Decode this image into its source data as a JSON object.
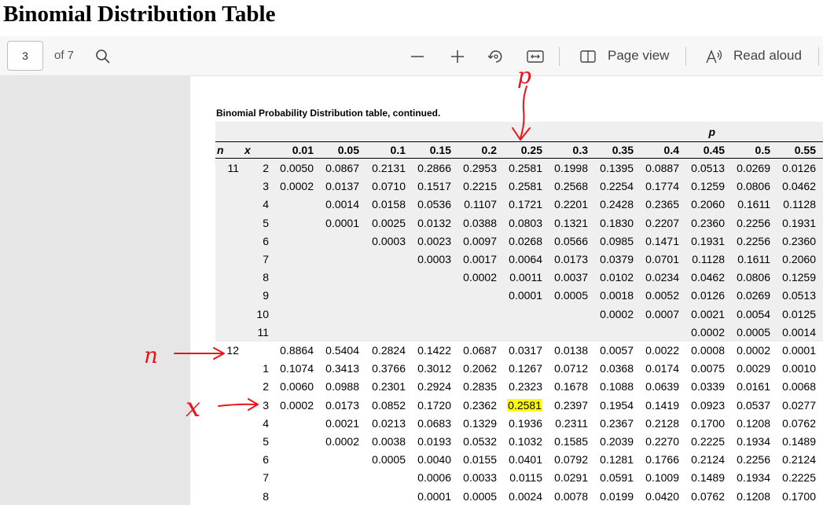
{
  "title": "Binomial Distribution Table",
  "toolbar": {
    "page_number": "3",
    "page_of": "of 7",
    "page_view_label": "Page view",
    "read_aloud_label": "Read aloud",
    "icons": [
      "search-icon",
      "zoom-out-icon",
      "zoom-in-icon",
      "rotate-icon",
      "fit-width-icon",
      "page-view-icon",
      "read-aloud-icon"
    ]
  },
  "document": {
    "caption": "Binomial Probability Distribution table, continued.",
    "p_header": "p",
    "n_header": "n",
    "x_header": "x",
    "p_values": [
      "0.01",
      "0.05",
      "0.1",
      "0.15",
      "0.2",
      "0.25",
      "0.3",
      "0.35",
      "0.4",
      "0.45",
      "0.5",
      "0.55"
    ],
    "rows": [
      {
        "n": "11",
        "x": "2",
        "cells": [
          "0.0050",
          "0.0867",
          "0.2131",
          "0.2866",
          "0.2953",
          "0.2581",
          "0.1998",
          "0.1395",
          "0.0887",
          "0.0513",
          "0.0269",
          "0.0126"
        ]
      },
      {
        "n": "",
        "x": "3",
        "cells": [
          "0.0002",
          "0.0137",
          "0.0710",
          "0.1517",
          "0.2215",
          "0.2581",
          "0.2568",
          "0.2254",
          "0.1774",
          "0.1259",
          "0.0806",
          "0.0462"
        ]
      },
      {
        "n": "",
        "x": "4",
        "cells": [
          "",
          "0.0014",
          "0.0158",
          "0.0536",
          "0.1107",
          "0.1721",
          "0.2201",
          "0.2428",
          "0.2365",
          "0.2060",
          "0.1611",
          "0.1128"
        ]
      },
      {
        "n": "",
        "x": "5",
        "cells": [
          "",
          "0.0001",
          "0.0025",
          "0.0132",
          "0.0388",
          "0.0803",
          "0.1321",
          "0.1830",
          "0.2207",
          "0.2360",
          "0.2256",
          "0.1931"
        ]
      },
      {
        "n": "",
        "x": "6",
        "cells": [
          "",
          "",
          "0.0003",
          "0.0023",
          "0.0097",
          "0.0268",
          "0.0566",
          "0.0985",
          "0.1471",
          "0.1931",
          "0.2256",
          "0.2360"
        ]
      },
      {
        "n": "",
        "x": "7",
        "cells": [
          "",
          "",
          "",
          "0.0003",
          "0.0017",
          "0.0064",
          "0.0173",
          "0.0379",
          "0.0701",
          "0.1128",
          "0.1611",
          "0.2060"
        ]
      },
      {
        "n": "",
        "x": "8",
        "cells": [
          "",
          "",
          "",
          "",
          "0.0002",
          "0.0011",
          "0.0037",
          "0.0102",
          "0.0234",
          "0.0462",
          "0.0806",
          "0.1259"
        ]
      },
      {
        "n": "",
        "x": "9",
        "cells": [
          "",
          "",
          "",
          "",
          "",
          "0.0001",
          "0.0005",
          "0.0018",
          "0.0052",
          "0.0126",
          "0.0269",
          "0.0513"
        ]
      },
      {
        "n": "",
        "x": "10",
        "cells": [
          "",
          "",
          "",
          "",
          "",
          "",
          "",
          "0.0002",
          "0.0007",
          "0.0021",
          "0.0054",
          "0.0125"
        ]
      },
      {
        "n": "",
        "x": "11",
        "cells": [
          "",
          "",
          "",
          "",
          "",
          "",
          "",
          "",
          "",
          "0.0002",
          "0.0005",
          "0.0014"
        ]
      },
      {
        "n": "12",
        "x": "",
        "cells": [
          "0.8864",
          "0.5404",
          "0.2824",
          "0.1422",
          "0.0687",
          "0.0317",
          "0.0138",
          "0.0057",
          "0.0022",
          "0.0008",
          "0.0002",
          "0.0001"
        ]
      },
      {
        "n": "",
        "x": "1",
        "cells": [
          "0.1074",
          "0.3413",
          "0.3766",
          "0.3012",
          "0.2062",
          "0.1267",
          "0.0712",
          "0.0368",
          "0.0174",
          "0.0075",
          "0.0029",
          "0.0010"
        ]
      },
      {
        "n": "",
        "x": "2",
        "cells": [
          "0.0060",
          "0.0988",
          "0.2301",
          "0.2924",
          "0.2835",
          "0.2323",
          "0.1678",
          "0.1088",
          "0.0639",
          "0.0339",
          "0.0161",
          "0.0068"
        ]
      },
      {
        "n": "",
        "x": "3",
        "cells": [
          "0.0002",
          "0.0173",
          "0.0852",
          "0.1720",
          "0.2362",
          "0.2581",
          "0.2397",
          "0.1954",
          "0.1419",
          "0.0923",
          "0.0537",
          "0.0277"
        ]
      },
      {
        "n": "",
        "x": "4",
        "cells": [
          "",
          "0.0021",
          "0.0213",
          "0.0683",
          "0.1329",
          "0.1936",
          "0.2311",
          "0.2367",
          "0.2128",
          "0.1700",
          "0.1208",
          "0.0762"
        ]
      },
      {
        "n": "",
        "x": "5",
        "cells": [
          "",
          "0.0002",
          "0.0038",
          "0.0193",
          "0.0532",
          "0.1032",
          "0.1585",
          "0.2039",
          "0.2270",
          "0.2225",
          "0.1934",
          "0.1489"
        ]
      },
      {
        "n": "",
        "x": "6",
        "cells": [
          "",
          "",
          "0.0005",
          "0.0040",
          "0.0155",
          "0.0401",
          "0.0792",
          "0.1281",
          "0.1766",
          "0.2124",
          "0.2256",
          "0.2124"
        ]
      },
      {
        "n": "",
        "x": "7",
        "cells": [
          "",
          "",
          "",
          "0.0006",
          "0.0033",
          "0.0115",
          "0.0291",
          "0.0591",
          "0.1009",
          "0.1489",
          "0.1934",
          "0.2225"
        ]
      },
      {
        "n": "",
        "x": "8",
        "cells": [
          "",
          "",
          "",
          "0.0001",
          "0.0005",
          "0.0024",
          "0.0078",
          "0.0199",
          "0.0420",
          "0.0762",
          "0.1208",
          "0.1700"
        ]
      }
    ],
    "highlight": {
      "row": 13,
      "col": 5,
      "color": "#ffff00"
    }
  },
  "annotations": {
    "color": "#e8141c",
    "p_label": "p",
    "n_label": "n",
    "x_label": "x"
  }
}
